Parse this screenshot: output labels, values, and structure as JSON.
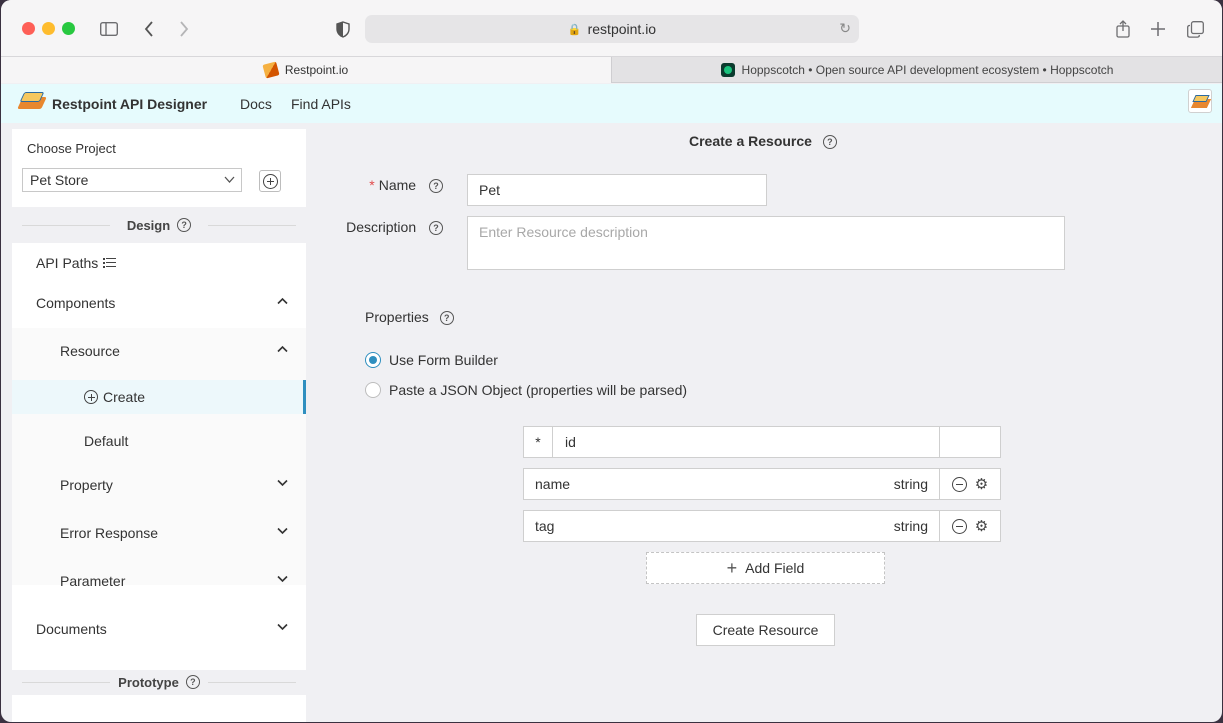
{
  "browser": {
    "url": "restpoint.io",
    "tabs": [
      {
        "label": "Restpoint.io"
      },
      {
        "label": "Hoppscotch • Open source API development ecosystem • Hoppscotch"
      }
    ]
  },
  "header": {
    "brand": "Restpoint API Designer",
    "nav": [
      "Docs",
      "Find APIs"
    ]
  },
  "sidebar": {
    "choose_project_label": "Choose Project",
    "project_selected": "Pet Store",
    "design_title": "Design",
    "prototype_title": "Prototype",
    "items": {
      "api_paths": "API Paths",
      "components": "Components",
      "resource": "Resource",
      "create": "Create",
      "default": "Default",
      "property": "Property",
      "error_response": "Error Response",
      "parameter": "Parameter",
      "documents": "Documents"
    }
  },
  "form": {
    "title": "Create a Resource",
    "name_label": "Name",
    "name_value": "Pet",
    "description_label": "Description",
    "description_placeholder": "Enter Resource description",
    "properties_label": "Properties",
    "radio_form_builder": "Use Form Builder",
    "radio_json": "Paste a JSON Object (properties will be parsed)",
    "fields": [
      {
        "required": "*",
        "name": "id",
        "type": ""
      },
      {
        "name": "name",
        "type": "string"
      },
      {
        "name": "tag",
        "type": "string"
      }
    ],
    "add_field_label": "Add Field",
    "submit_label": "Create Resource"
  }
}
